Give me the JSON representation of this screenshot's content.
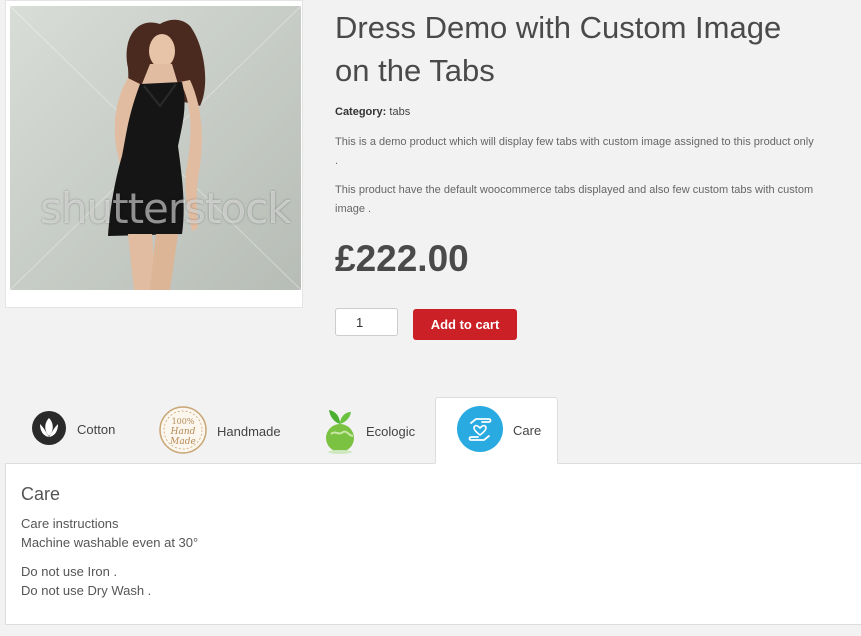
{
  "product": {
    "title": "Dress Demo with Custom Image on the Tabs",
    "category_label": "Category:",
    "category_value": "tabs",
    "description_1": "This is a demo product which will display few tabs with custom image assigned to this product only .",
    "description_2": "This product have the default woocommerce tabs displayed and also few custom tabs with custom image .",
    "price": "£222.00",
    "quantity": "1",
    "add_to_cart_label": "Add to cart",
    "image_watermark": "shutterstock"
  },
  "tabs": [
    {
      "label": "Cotton",
      "icon": "cotton-icon"
    },
    {
      "label": "Handmade",
      "icon": "handmade-badge-icon",
      "badge_text": "100% Hand Made"
    },
    {
      "label": "Ecologic",
      "icon": "eco-globe-icon"
    },
    {
      "label": "Care",
      "icon": "care-hands-icon",
      "active": true
    }
  ],
  "panel": {
    "heading": "Care",
    "line_1": "Care instructions",
    "line_2": "Machine washable even at 30°",
    "line_3": "Do not use Iron .",
    "line_4": "Do not use Dry Wash ."
  },
  "colors": {
    "accent_red": "#cb2026",
    "care_blue": "#29abe2",
    "background": "#f2f2f2"
  }
}
